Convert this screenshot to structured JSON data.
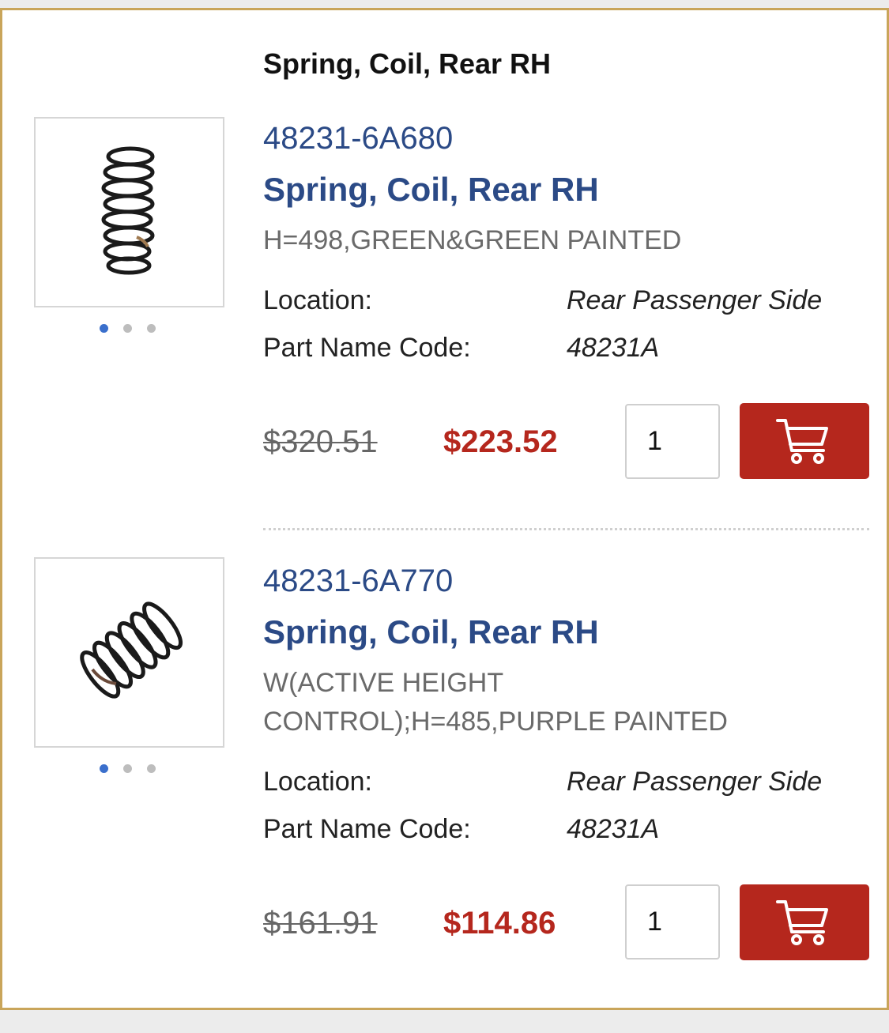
{
  "group_title": "Spring, Coil, Rear RH",
  "items": [
    {
      "part_number": "48231-6A680",
      "name": "Spring, Coil, Rear RH",
      "description": "H=498,GREEN&GREEN PAINTED",
      "specs": [
        {
          "label": "Location:",
          "value": "Rear Passenger Side"
        },
        {
          "label": "Part Name Code:",
          "value": "48231A"
        }
      ],
      "old_price": "$320.51",
      "price": "$223.52",
      "quantity": "1",
      "image_icon": "coil-spring-upright-icon",
      "carousel_dots": 3,
      "carousel_active": 0
    },
    {
      "part_number": "48231-6A770",
      "name": "Spring, Coil, Rear RH",
      "description": "W(ACTIVE HEIGHT CONTROL);H=485,PURPLE PAINTED",
      "specs": [
        {
          "label": "Location:",
          "value": "Rear Passenger Side"
        },
        {
          "label": "Part Name Code:",
          "value": "48231A"
        }
      ],
      "old_price": "$161.91",
      "price": "$114.86",
      "quantity": "1",
      "image_icon": "coil-spring-angled-icon",
      "carousel_dots": 3,
      "carousel_active": 0
    }
  ],
  "colors": {
    "accent_blue": "#2b4a86",
    "sale_red": "#b5271d",
    "card_border": "#c9a55a",
    "active_dot": "#3a6fcc"
  },
  "icons": {
    "cart": "shopping-cart-icon"
  }
}
